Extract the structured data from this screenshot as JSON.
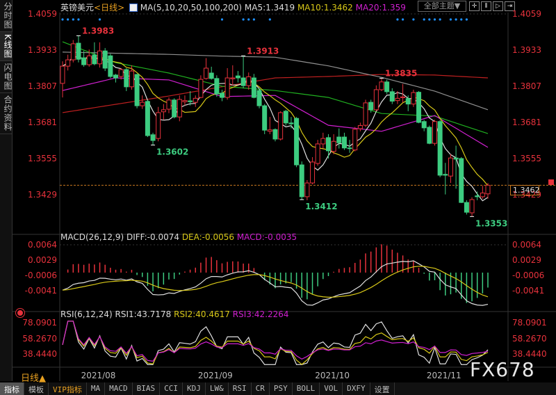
{
  "sidebar": {
    "tabs": [
      "分时图",
      "K线图",
      "闪电图",
      "合约资料"
    ],
    "active": 1
  },
  "header": {
    "symbol": "英镑美元",
    "period": "<日线>",
    "ma_label": "MA(5,10,20,50,100,200)",
    "ma5": "MA5:1.3419",
    "ma10": "MA10:1.3462",
    "ma20": "MA20:1.359",
    "theme": "全部主题▼"
  },
  "macd_header": {
    "label": "MACD(26,12,9)",
    "diff": "DIFF:-0.0074",
    "dea": "DEA:-0.0056",
    "macd": "MACD:-0.0035"
  },
  "rsi_header": {
    "label": "RSI(6,12,24)",
    "rsi1": "RSI1:43.7178",
    "rsi2": "RSI2:40.4617",
    "rsi3": "RSI3:42.2264"
  },
  "bottom": {
    "period": "日线▲",
    "watermark": "FX678"
  },
  "tabs": [
    "指标",
    "模板",
    "VIP指标",
    "MA",
    "MACD",
    "BIAS",
    "CCI",
    "KDJ",
    "LW&",
    "RSI",
    "CR",
    "PSY",
    "BOLL",
    "VOL",
    "DXFY",
    "设置"
  ],
  "current_price": "1.3462",
  "colors": {
    "up": "#e8323c",
    "down": "#3dcc80",
    "ma5": "#e0e0e0",
    "ma10": "#d8c818",
    "ma20": "#d020d0",
    "ma50": "#20b020",
    "ma100": "#909090",
    "ma200": "#c02020",
    "price_line": "#c87820",
    "marker": "#1e90ff"
  },
  "chart_data": {
    "type": "candlestick",
    "price_axis": {
      "ticks": [
        "1.4059",
        "1.3933",
        "1.3807",
        "1.3681",
        "1.3555",
        "1.3429"
      ],
      "ylim": [
        1.3338,
        1.4059
      ]
    },
    "macd_axis": {
      "ticks": [
        "0.0064",
        "0.0029",
        "-0.0006",
        "-0.0041"
      ]
    },
    "rsi_axis": {
      "ticks": [
        "78.0901",
        "58.2670",
        "38.4440"
      ]
    },
    "x_ticks": [
      "2021/08",
      "2021/09",
      "2021/10",
      "2021/11"
    ],
    "x_tick_indices": [
      4,
      26,
      48,
      69
    ],
    "annotations": [
      {
        "text": "1.3983",
        "index": 3
      },
      {
        "text": "1.3602",
        "index": 17
      },
      {
        "text": "1.3913",
        "index": 34
      },
      {
        "text": "1.3412",
        "index": 45
      },
      {
        "text": "1.3835",
        "index": 60
      },
      {
        "text": "1.3353",
        "index": 77
      }
    ],
    "event_marker_indices": [
      0,
      1,
      2,
      3,
      7,
      30,
      34,
      35,
      36,
      39,
      63,
      64,
      66,
      68,
      69,
      70,
      71,
      73,
      74,
      75,
      76
    ],
    "ohlc": [
      [
        1.3817,
        1.3894,
        1.3768,
        1.3877
      ],
      [
        1.3877,
        1.3917,
        1.3862,
        1.3899
      ],
      [
        1.3899,
        1.3968,
        1.389,
        1.3955
      ],
      [
        1.3957,
        1.3983,
        1.389,
        1.3901
      ],
      [
        1.3906,
        1.393,
        1.3875,
        1.3882
      ],
      [
        1.3882,
        1.3935,
        1.3875,
        1.3913
      ],
      [
        1.3916,
        1.396,
        1.388,
        1.3885
      ],
      [
        1.3885,
        1.396,
        1.3872,
        1.393
      ],
      [
        1.393,
        1.394,
        1.386,
        1.387
      ],
      [
        1.3913,
        1.392,
        1.3835,
        1.3841
      ],
      [
        1.3846,
        1.385,
        1.382,
        1.3836
      ],
      [
        1.3841,
        1.387,
        1.383,
        1.3865
      ],
      [
        1.3865,
        1.387,
        1.379,
        1.3805
      ],
      [
        1.3805,
        1.388,
        1.3795,
        1.386
      ],
      [
        1.3848,
        1.385,
        1.373,
        1.3739
      ],
      [
        1.3739,
        1.3775,
        1.3728,
        1.3751
      ],
      [
        1.3754,
        1.376,
        1.363,
        1.3635
      ],
      [
        1.3638,
        1.3645,
        1.3602,
        1.3618
      ],
      [
        1.3625,
        1.3735,
        1.3615,
        1.3715
      ],
      [
        1.3718,
        1.3745,
        1.369,
        1.3725
      ],
      [
        1.3727,
        1.3768,
        1.3713,
        1.3759
      ],
      [
        1.3759,
        1.3765,
        1.3695,
        1.37
      ],
      [
        1.37,
        1.3775,
        1.3685,
        1.3761
      ],
      [
        1.3753,
        1.3775,
        1.374,
        1.3757
      ],
      [
        1.3756,
        1.379,
        1.374,
        1.3753
      ],
      [
        1.3751,
        1.3775,
        1.3735,
        1.3765
      ],
      [
        1.3768,
        1.3845,
        1.3765,
        1.3831
      ],
      [
        1.3834,
        1.3905,
        1.383,
        1.387
      ],
      [
        1.3853,
        1.3875,
        1.383,
        1.3834
      ],
      [
        1.3834,
        1.3845,
        1.377,
        1.378
      ],
      [
        1.3783,
        1.3795,
        1.3755,
        1.3768
      ],
      [
        1.3768,
        1.387,
        1.376,
        1.3836
      ],
      [
        1.3833,
        1.388,
        1.381,
        1.3836
      ],
      [
        1.3843,
        1.386,
        1.382,
        1.3836
      ],
      [
        1.3836,
        1.3913,
        1.38,
        1.3809
      ],
      [
        1.3809,
        1.3855,
        1.3795,
        1.384
      ],
      [
        1.3836,
        1.385,
        1.3765,
        1.3768
      ],
      [
        1.3792,
        1.38,
        1.373,
        1.3739
      ],
      [
        1.3739,
        1.3745,
        1.364,
        1.3654
      ],
      [
        1.365,
        1.37,
        1.364,
        1.3655
      ],
      [
        1.3656,
        1.366,
        1.3615,
        1.3623
      ],
      [
        1.3623,
        1.372,
        1.3618,
        1.3715
      ],
      [
        1.372,
        1.3725,
        1.367,
        1.3679
      ],
      [
        1.3679,
        1.37,
        1.366,
        1.3676
      ],
      [
        1.3695,
        1.37,
        1.3525,
        1.3533
      ],
      [
        1.3533,
        1.3545,
        1.3412,
        1.3422
      ],
      [
        1.3422,
        1.348,
        1.341,
        1.347
      ],
      [
        1.347,
        1.356,
        1.3465,
        1.3543
      ],
      [
        1.3538,
        1.362,
        1.353,
        1.3606
      ],
      [
        1.3606,
        1.3645,
        1.359,
        1.3625
      ],
      [
        1.3628,
        1.364,
        1.3555,
        1.3582
      ],
      [
        1.358,
        1.364,
        1.357,
        1.3615
      ],
      [
        1.363,
        1.366,
        1.359,
        1.361
      ],
      [
        1.363,
        1.3645,
        1.3585,
        1.3592
      ],
      [
        1.3592,
        1.362,
        1.3575,
        1.359
      ],
      [
        1.3585,
        1.3665,
        1.358,
        1.3657
      ],
      [
        1.3659,
        1.368,
        1.365,
        1.367
      ],
      [
        1.3671,
        1.376,
        1.3665,
        1.3749
      ],
      [
        1.3751,
        1.376,
        1.3715,
        1.3725
      ],
      [
        1.3725,
        1.381,
        1.372,
        1.3795
      ],
      [
        1.3795,
        1.3835,
        1.379,
        1.3822
      ],
      [
        1.3822,
        1.383,
        1.378,
        1.3788
      ],
      [
        1.3788,
        1.38,
        1.3745,
        1.3755
      ],
      [
        1.3757,
        1.379,
        1.3745,
        1.3765
      ],
      [
        1.3767,
        1.3815,
        1.375,
        1.377
      ],
      [
        1.3764,
        1.3775,
        1.372,
        1.3745
      ],
      [
        1.3745,
        1.3795,
        1.3735,
        1.3785
      ],
      [
        1.3786,
        1.379,
        1.3678,
        1.3681
      ],
      [
        1.3684,
        1.369,
        1.365,
        1.3662
      ],
      [
        1.3664,
        1.367,
        1.3605,
        1.3608
      ],
      [
        1.3608,
        1.369,
        1.36,
        1.3684
      ],
      [
        1.3684,
        1.369,
        1.349,
        1.3497
      ],
      [
        1.35,
        1.354,
        1.343,
        1.3497
      ],
      [
        1.3494,
        1.357,
        1.347,
        1.3557
      ],
      [
        1.3557,
        1.36,
        1.345,
        1.3553
      ],
      [
        1.3555,
        1.356,
        1.34,
        1.3402
      ],
      [
        1.3402,
        1.341,
        1.336,
        1.3368
      ],
      [
        1.3366,
        1.342,
        1.3353,
        1.3412
      ],
      [
        1.3425,
        1.344,
        1.341,
        1.3422
      ],
      [
        1.3422,
        1.346,
        1.3415,
        1.3435
      ],
      [
        1.3432,
        1.347,
        1.3415,
        1.3462
      ]
    ],
    "ma_sampled": {
      "indices": [
        0,
        10,
        20,
        30,
        40,
        50,
        60,
        70,
        80
      ],
      "ma20": [
        1.3792,
        1.3836,
        1.3829,
        1.3771,
        1.3775,
        1.3671,
        1.365,
        1.3705,
        1.3594
      ],
      "ma50": [
        1.3962,
        1.3889,
        1.3853,
        1.3807,
        1.3792,
        1.3768,
        1.3712,
        1.3703,
        1.3642
      ],
      "ma100": [
        1.3926,
        1.3922,
        1.3918,
        1.3912,
        1.3908,
        1.3878,
        1.3838,
        1.379,
        1.3725
      ],
      "ma200": [
        1.3715,
        1.3744,
        1.3773,
        1.3805,
        1.3836,
        1.3841,
        1.3848,
        1.3846,
        1.3836
      ]
    }
  }
}
